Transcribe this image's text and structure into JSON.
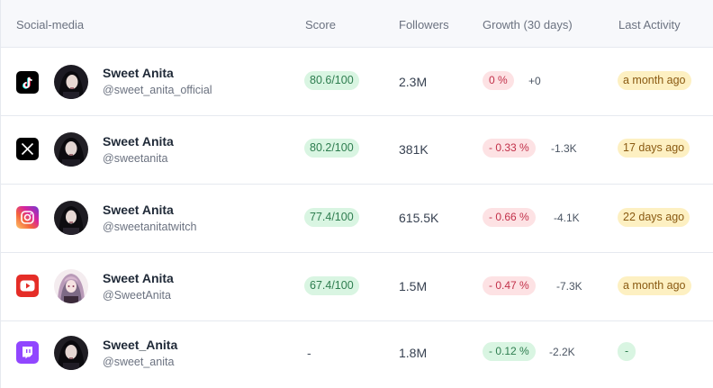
{
  "columns": {
    "social": "Social-media",
    "score": "Score",
    "followers": "Followers",
    "growth": "Growth (30 days)",
    "activity": "Last Activity"
  },
  "rows": [
    {
      "platform": "tiktok-icon",
      "name": "Sweet Anita",
      "handle": "@sweet_anita_official",
      "score": "80.6/100",
      "followers": "2.3M",
      "growth": "0 %",
      "growth_type": "neg",
      "delta": "+0",
      "activity": "a month ago",
      "activity_type": "warn"
    },
    {
      "platform": "x-icon",
      "name": "Sweet Anita",
      "handle": "@sweetanita",
      "score": "80.2/100",
      "followers": "381K",
      "growth": "- 0.33 %",
      "growth_type": "neg",
      "delta": "-1.3K",
      "activity": "17 days ago",
      "activity_type": "warn"
    },
    {
      "platform": "instagram-icon",
      "name": "Sweet Anita",
      "handle": "@sweetanitatwitch",
      "score": "77.4/100",
      "followers": "615.5K",
      "growth": "- 0.66 %",
      "growth_type": "neg",
      "delta": "-4.1K",
      "activity": "22 days ago",
      "activity_type": "warn"
    },
    {
      "platform": "youtube-icon",
      "name": "Sweet Anita",
      "handle": "@SweetAnita",
      "score": "67.4/100",
      "followers": "1.5M",
      "growth": "- 0.47 %",
      "growth_type": "neg",
      "delta": "-7.3K",
      "activity": "a month ago",
      "activity_type": "warn"
    },
    {
      "platform": "twitch-icon",
      "name": "Sweet_Anita",
      "handle": "@sweet_anita",
      "score": "-",
      "followers": "1.8M",
      "growth": "- 0.12 %",
      "growth_type": "pos",
      "delta": "-2.2K",
      "activity": "-",
      "activity_type": "ok"
    }
  ]
}
